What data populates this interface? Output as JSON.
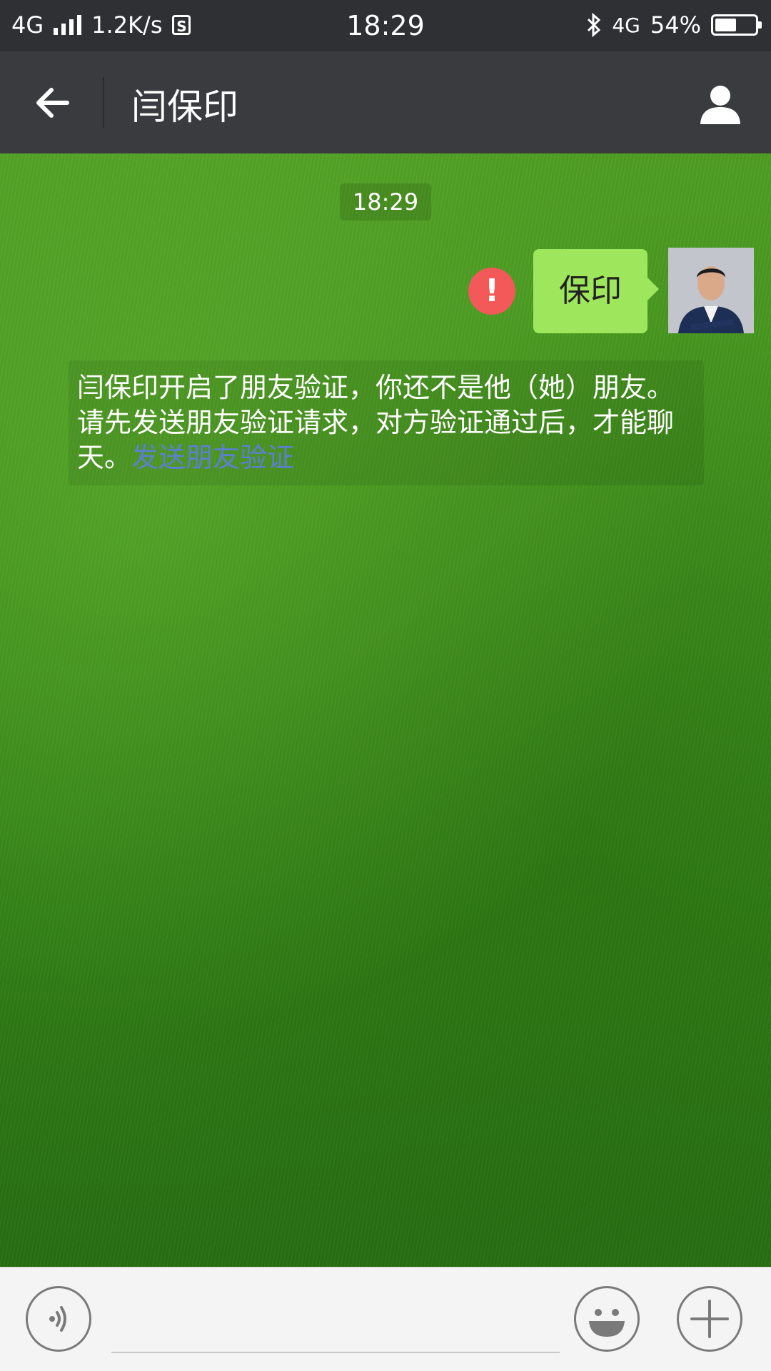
{
  "status_bar": {
    "network_left": "4G",
    "speed": "1.2K/s",
    "sim_badge": "S",
    "time": "18:29",
    "network_right": "4G",
    "battery": "54%",
    "battery_level": 0.54
  },
  "header": {
    "title": "闫保印",
    "back_icon": "back-arrow-icon",
    "contact_icon": "person-icon"
  },
  "chat": {
    "timestamp": "18:29",
    "messages": [
      {
        "text": "保印",
        "status": "failed"
      }
    ],
    "system_notice": {
      "text": "闫保印开启了朋友验证，你还不是他（她）朋友。请先发送朋友验证请求，对方验证通过后，才能聊天。",
      "link": "发送朋友验证"
    }
  },
  "input_bar": {
    "voice_icon": "voice-icon",
    "emoji_icon": "emoji-icon",
    "plus_icon": "plus-icon",
    "placeholder": ""
  },
  "colors": {
    "bubble": "#9ee65b",
    "error": "#f35959",
    "link": "#5c7fd4",
    "header": "#3a3b3f"
  }
}
